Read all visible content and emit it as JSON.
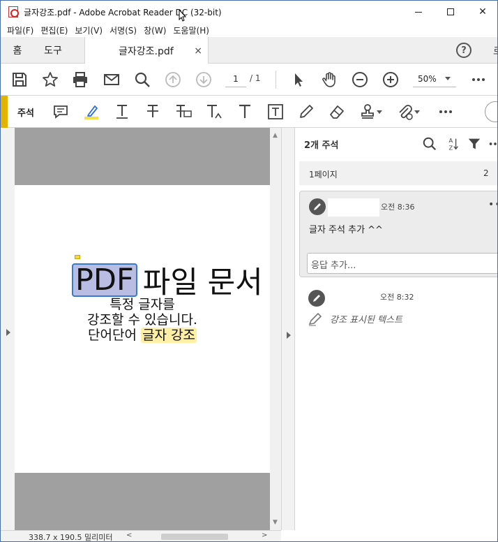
{
  "window": {
    "title": "글자강조.pdf - Adobe Acrobat Reader DC (32-bit)",
    "controls": {
      "minimize": "—",
      "maximize": "□",
      "close": "✕"
    }
  },
  "menu": [
    "파일(F)",
    "편집(E)",
    "보기(V)",
    "서명(S)",
    "창(W)",
    "도움말(H)"
  ],
  "tabs": {
    "home": "홈",
    "tools": "도구",
    "document": "글자강조.pdf",
    "close": "×",
    "help": "?",
    "signin": "로"
  },
  "toolbar": {
    "icons": [
      "save-icon",
      "star-icon",
      "print-icon",
      "mail-icon",
      "search-icon",
      "page-up-icon",
      "page-down-icon",
      "select-cursor-icon",
      "hand-icon",
      "zoom-out-icon",
      "zoom-in-icon",
      "more-icon"
    ],
    "page_current": "1",
    "page_total": "/ 1",
    "zoom": "50%"
  },
  "comment_toolbar": {
    "label": "주석",
    "icons": [
      "sticky-note-icon",
      "highlight-icon",
      "underline-icon",
      "strikethrough-icon",
      "replace-text-icon",
      "insert-text-icon",
      "text-icon",
      "textbox-icon",
      "pencil-icon",
      "eraser-icon",
      "stamp-icon",
      "attach-icon",
      "more-icon"
    ],
    "accent": "#e2b400"
  },
  "document": {
    "line1_highlighted": "PDF",
    "line1_rest": "파일 문서",
    "line2": "특정 글자를",
    "line3": "강조할 수 있습니다.",
    "line4_plain": "단어단어",
    "line4_highlighted": "글자 강조",
    "highlight_color": "#fdf0a6",
    "selection_color": "#b9bde4"
  },
  "comments_pane": {
    "count_label": "2개 주석",
    "page_group": "1페이지",
    "page_group_count": "2",
    "comments": [
      {
        "time": "오전 8:36",
        "text": "글자 주석 추가 ^^",
        "reply_placeholder": "응답 추가...",
        "more": "•••"
      },
      {
        "time": "오전 8:32",
        "text": "강조 표시된 텍스트"
      }
    ]
  },
  "statusbar": {
    "dimensions": "338.7 x 190.5 밀리미터"
  }
}
